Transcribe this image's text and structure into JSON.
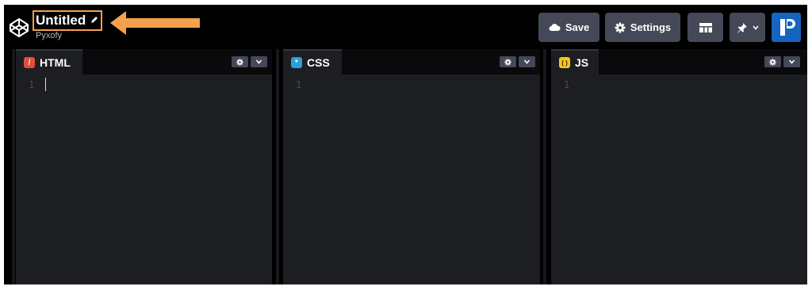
{
  "header": {
    "title": "Untitled",
    "owner": "Pyxofy",
    "save_label": "Save",
    "settings_label": "Settings"
  },
  "editors": [
    {
      "label": "HTML",
      "line": "1",
      "icon_color": "#e44d3a",
      "icon": "/"
    },
    {
      "label": "CSS",
      "line": "1",
      "icon_color": "#2d9fd9",
      "icon": "*"
    },
    {
      "label": "JS",
      "line": "1",
      "icon_color": "#f7c41f",
      "icon": "( )"
    }
  ],
  "colors": {
    "annotation": "#f5a04a",
    "button_bg": "#444857",
    "avatar_bg": "#1565c0"
  },
  "icons": {
    "logo": "codepen-cube-icon",
    "pencil": "pencil-icon",
    "save": "cloud-icon",
    "settings": "gear-icon",
    "layout": "layout-columns-icon",
    "pin": "pin-icon",
    "avatar": "user-avatar"
  }
}
